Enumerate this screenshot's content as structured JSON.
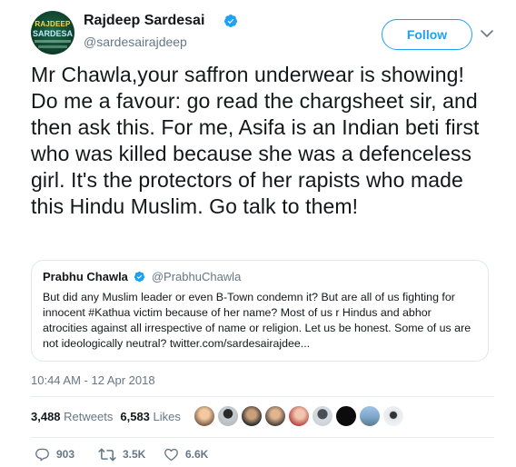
{
  "author": {
    "avatar_text_line1": "RAJDEEP",
    "avatar_text_line2": "SARDESA",
    "name": "Rajdeep Sardesai",
    "handle": "@sardesairajdeep"
  },
  "follow_label": "Follow",
  "tweet_text": "Mr Chawla,your saffron underwear is showing! Do me a favour: go read the chargsheet sir, and then ask this. For me, Asifa is an Indian beti first who was killed because she was a defenceless girl. It's the protectors of her rapists who made this Hindu Muslim. Go talk to them!",
  "quoted": {
    "name": "Prabhu Chawla",
    "handle": "@PrabhuChawla",
    "text": "But did any Muslim leader or even B-Town condemn it? But are all of us fighting for innocent #Kathua victim because of her name? Most of us r Hindus and abhor atrocities against all irrespective of name or religion. Let us be honest. Some of us are not ideologically neutral? twitter.com/sardesairajdee..."
  },
  "timestamp": "10:44 AM - 12 Apr 2018",
  "stats": {
    "retweets_count": "3,488",
    "retweets_label": "Retweets",
    "likes_count": "6,583",
    "likes_label": "Likes"
  },
  "actions": {
    "replies": "903",
    "retweets": "3.5K",
    "likes": "6.6K"
  },
  "colors": {
    "accent": "#1da1f2",
    "secondary_text": "#657786",
    "primary_text": "#14171a",
    "border": "#e1e8ed"
  },
  "icons": [
    "verified-badge-icon",
    "chevron-down-icon",
    "reply-icon",
    "retweet-icon",
    "heart-icon"
  ],
  "likers_count_shown": 9
}
